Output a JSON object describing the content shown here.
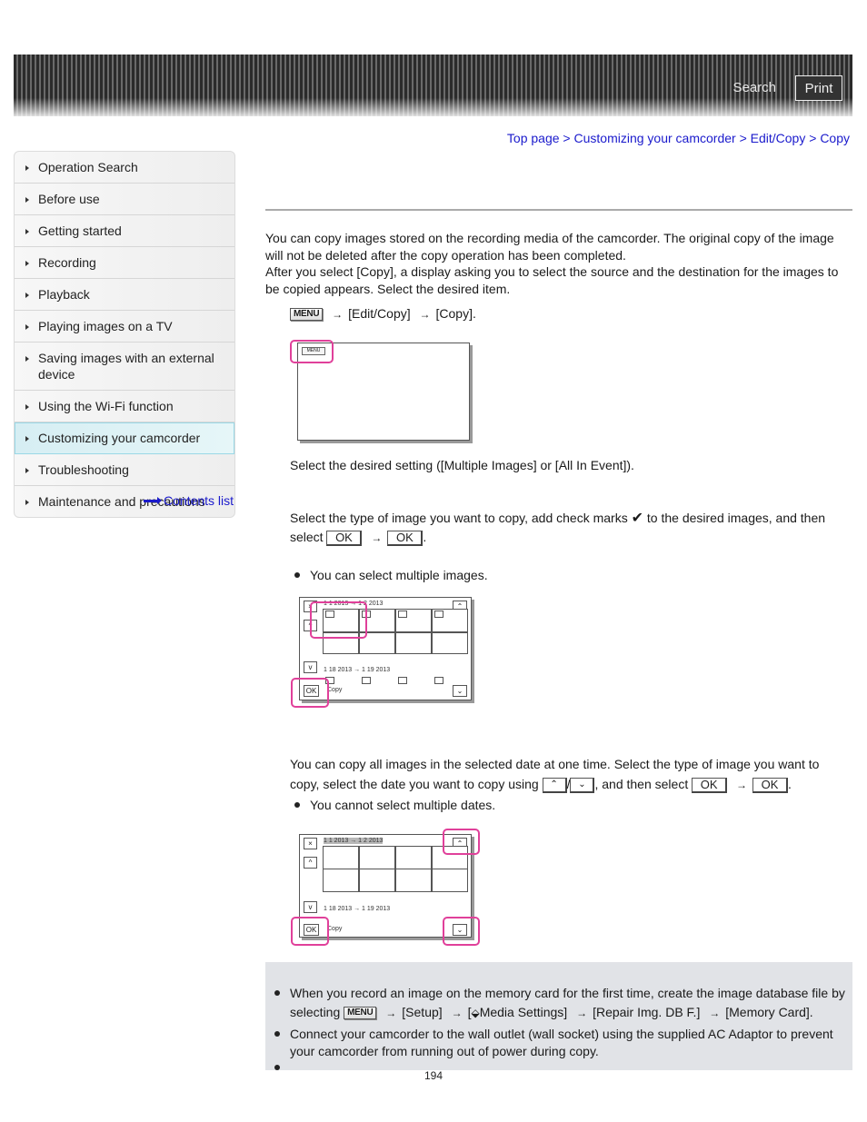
{
  "header": {
    "search_label": "Search",
    "print_label": "Print"
  },
  "breadcrumb": {
    "items": [
      "Top page",
      "Customizing your camcorder",
      "Edit/Copy",
      "Copy"
    ],
    "separator": ">"
  },
  "sidebar": {
    "items": [
      {
        "label": "Operation Search"
      },
      {
        "label": "Before use"
      },
      {
        "label": "Getting started"
      },
      {
        "label": "Recording"
      },
      {
        "label": "Playback"
      },
      {
        "label": "Playing images on a TV"
      },
      {
        "label": "Saving images with an external device"
      },
      {
        "label": "Using the Wi-Fi function"
      },
      {
        "label": "Customizing your camcorder",
        "active": true
      },
      {
        "label": "Troubleshooting"
      },
      {
        "label": "Maintenance and precautions"
      }
    ],
    "contents_link": "Contents list"
  },
  "main": {
    "intro_1": "You can copy images stored on the recording media of the camcorder. The original copy of the image will not be deleted after the copy operation has been completed.",
    "intro_2": "After you select [Copy], a display asking you to select the source and the destination for the images to be copied appears. Select the desired item.",
    "menu_key": "MENU",
    "step1": {
      "part1": "[Edit/Copy]",
      "part2": "[Copy]."
    },
    "arrow": "→",
    "step2": "Select the desired setting ([Multiple Images] or [All In Event]).",
    "multiple": {
      "text_a": "Select the type of image you want to copy, add check marks",
      "checkmark": "✔",
      "text_b": "to the desired images, and then",
      "text_c": "select",
      "ok_label": "OK",
      "period": ".",
      "bullet": "You can select multiple images."
    },
    "event": {
      "text_a": "You can copy all images in the selected date at one time. Select the type of image you want to",
      "text_b": "copy, select the date you want to copy using",
      "up_glyph": "⌃⌃",
      "down_glyph": "⌄⌄",
      "slash": "/",
      "text_c": ", and then select",
      "ok_label": "OK",
      "period": ".",
      "bullet": "You cannot select multiple dates."
    },
    "screen": {
      "close": "×",
      "ok": "OK",
      "copy_label": "Copy",
      "date_range_1": "1 1 2013 → 1 2 2013",
      "date_range_2": "1 18 2013 → 1 19 2013",
      "menu_mini": "MENU"
    }
  },
  "notes": {
    "note1_a": "When you record an image on the memory card for the first time, create the image database file by",
    "note1_b_prefix": "selecting",
    "note1_steps": [
      "[Setup]",
      "[",
      "Media Settings]",
      "[Repair Img. DB F.]",
      "[Memory Card]."
    ],
    "note2": "Connect your camcorder to the wall outlet (wall socket) using the supplied AC Adaptor to prevent your camcorder from running out of power during copy."
  },
  "page_number": "194"
}
